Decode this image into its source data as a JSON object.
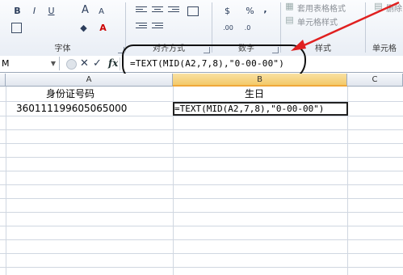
{
  "ribbon": {
    "font_group": {
      "label": "字体",
      "bold": "B",
      "italic": "I",
      "underline": "U",
      "grow": "A",
      "shrink": "A"
    },
    "align_group": {
      "label": "对齐方式"
    },
    "number_group": {
      "label": "数字",
      "currency": "$",
      "percent": "%",
      "comma": ","
    },
    "styles_group": {
      "label": "样式",
      "table_format": "套用表格格式",
      "cell_styles": "单元格样式"
    },
    "cells_group": {
      "label": "单元格",
      "delete": "删除"
    }
  },
  "formula_bar": {
    "name_box": "M",
    "cancel": "✕",
    "enter": "✓",
    "fx": "fx",
    "formula": "=TEXT(MID(A2,7,8),\"0-00-00\")"
  },
  "sheet": {
    "columns": [
      "A",
      "B",
      "C"
    ],
    "selected_column": "B",
    "rows": [
      {
        "a": "身份证号码",
        "b": "生日"
      },
      {
        "a": "360111199605065000",
        "b": "=TEXT(MID(A2,7,8),\"0-00-00\")"
      }
    ]
  },
  "annotation_color": "#e02020"
}
